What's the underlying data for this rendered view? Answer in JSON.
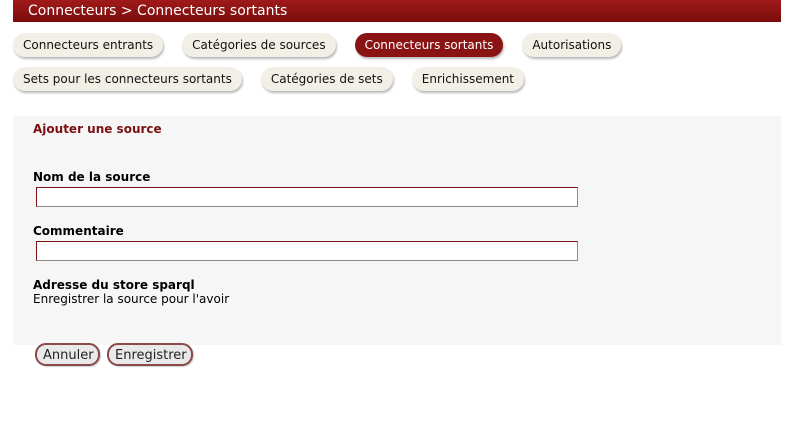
{
  "header": {
    "title": "Connecteurs > Connecteurs sortants"
  },
  "tabs": [
    {
      "label": "Connecteurs entrants"
    },
    {
      "label": "Catégories de sources"
    },
    {
      "label": "Connecteurs sortants"
    },
    {
      "label": "Autorisations"
    },
    {
      "label": "Sets pour les connecteurs sortants"
    },
    {
      "label": "Catégories de sets"
    },
    {
      "label": "Enrichissement"
    }
  ],
  "form": {
    "title": "Ajouter une source",
    "name_label": "Nom de la source",
    "name_value": "",
    "comment_label": "Commentaire",
    "comment_value": "",
    "address_label": "Adresse du store sparql",
    "address_text": "Enregistrer la source pour l'avoir"
  },
  "buttons": {
    "cancel": "Annuler",
    "save": "Enregistrer"
  },
  "colors": {
    "accent": "#8a1313",
    "tab_bg": "#f2efe6",
    "panel_bg": "#f6f6f6"
  }
}
